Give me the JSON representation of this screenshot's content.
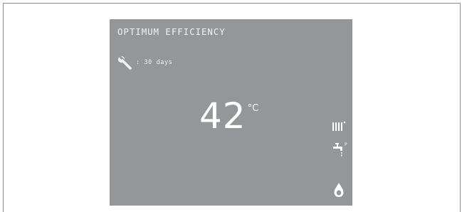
{
  "display": {
    "title": "OPTIMUM EFFICIENCY",
    "service_text": ": 30 days",
    "temperature": "42",
    "temperature_unit": "°C",
    "tap_superscript": "P"
  },
  "icons": {
    "service": "wrench-icon",
    "heating": "radiator-icon",
    "hot_water": "tap-icon",
    "burner": "flame-icon"
  },
  "colors": {
    "screen_background": "#949699",
    "text": "#ffffff",
    "frame": "#8e8e8e"
  }
}
